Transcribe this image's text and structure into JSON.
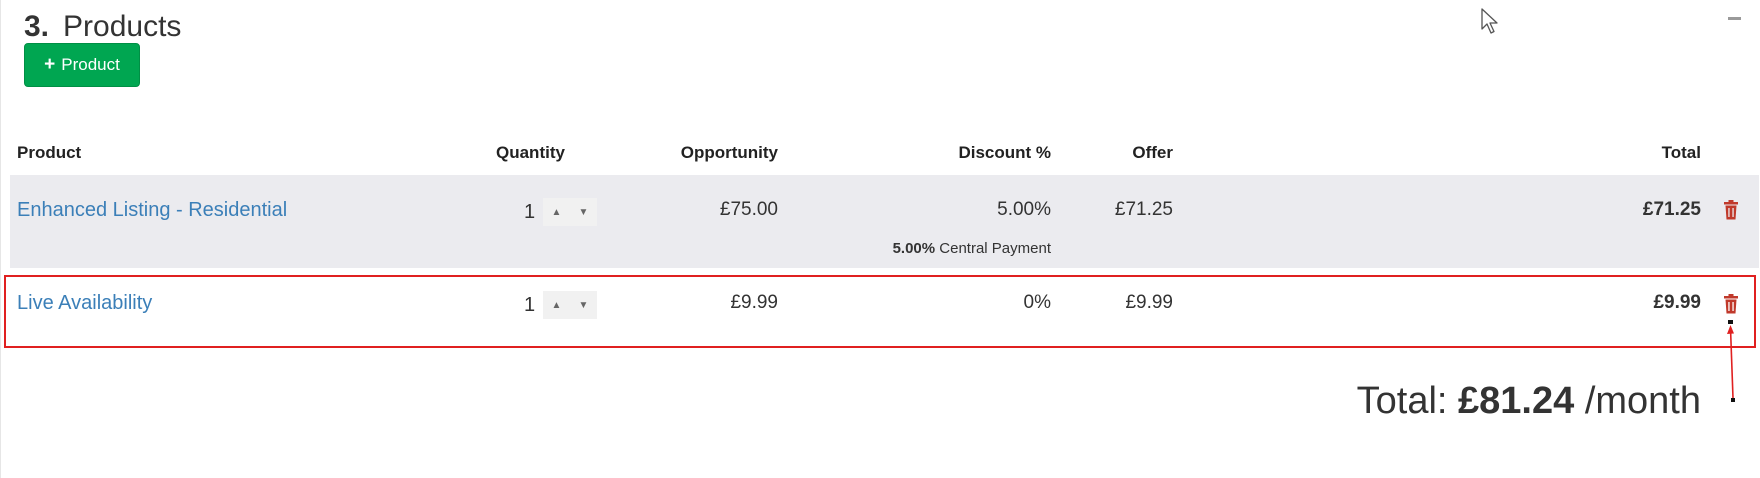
{
  "section": {
    "number": "3.",
    "title": "Products"
  },
  "add_button": {
    "icon": "plus-icon",
    "label": "Product"
  },
  "table": {
    "headers": {
      "product": "Product",
      "quantity": "Quantity",
      "opportunity": "Opportunity",
      "discount": "Discount %",
      "offer": "Offer",
      "total": "Total"
    },
    "rows": [
      {
        "product": "Enhanced Listing - Residential",
        "quantity": "1",
        "opportunity": "£75.00",
        "discount": "5.00%",
        "offer": "£71.25",
        "total": "£71.25",
        "note_value": "5.00%",
        "note_label": "Central Payment"
      },
      {
        "product": "Live Availability",
        "quantity": "1",
        "opportunity": "£9.99",
        "discount": "0%",
        "offer": "£9.99",
        "total": "£9.99"
      }
    ]
  },
  "grand_total": {
    "prefix": "Total: ",
    "amount": "£81.24",
    "suffix": " /month"
  },
  "colors": {
    "accent_green": "#00a651",
    "link_blue": "#3b7fb8",
    "delete_red": "#c0392b",
    "row_stripe": "#ebebef",
    "annotation_red": "#e02020"
  }
}
